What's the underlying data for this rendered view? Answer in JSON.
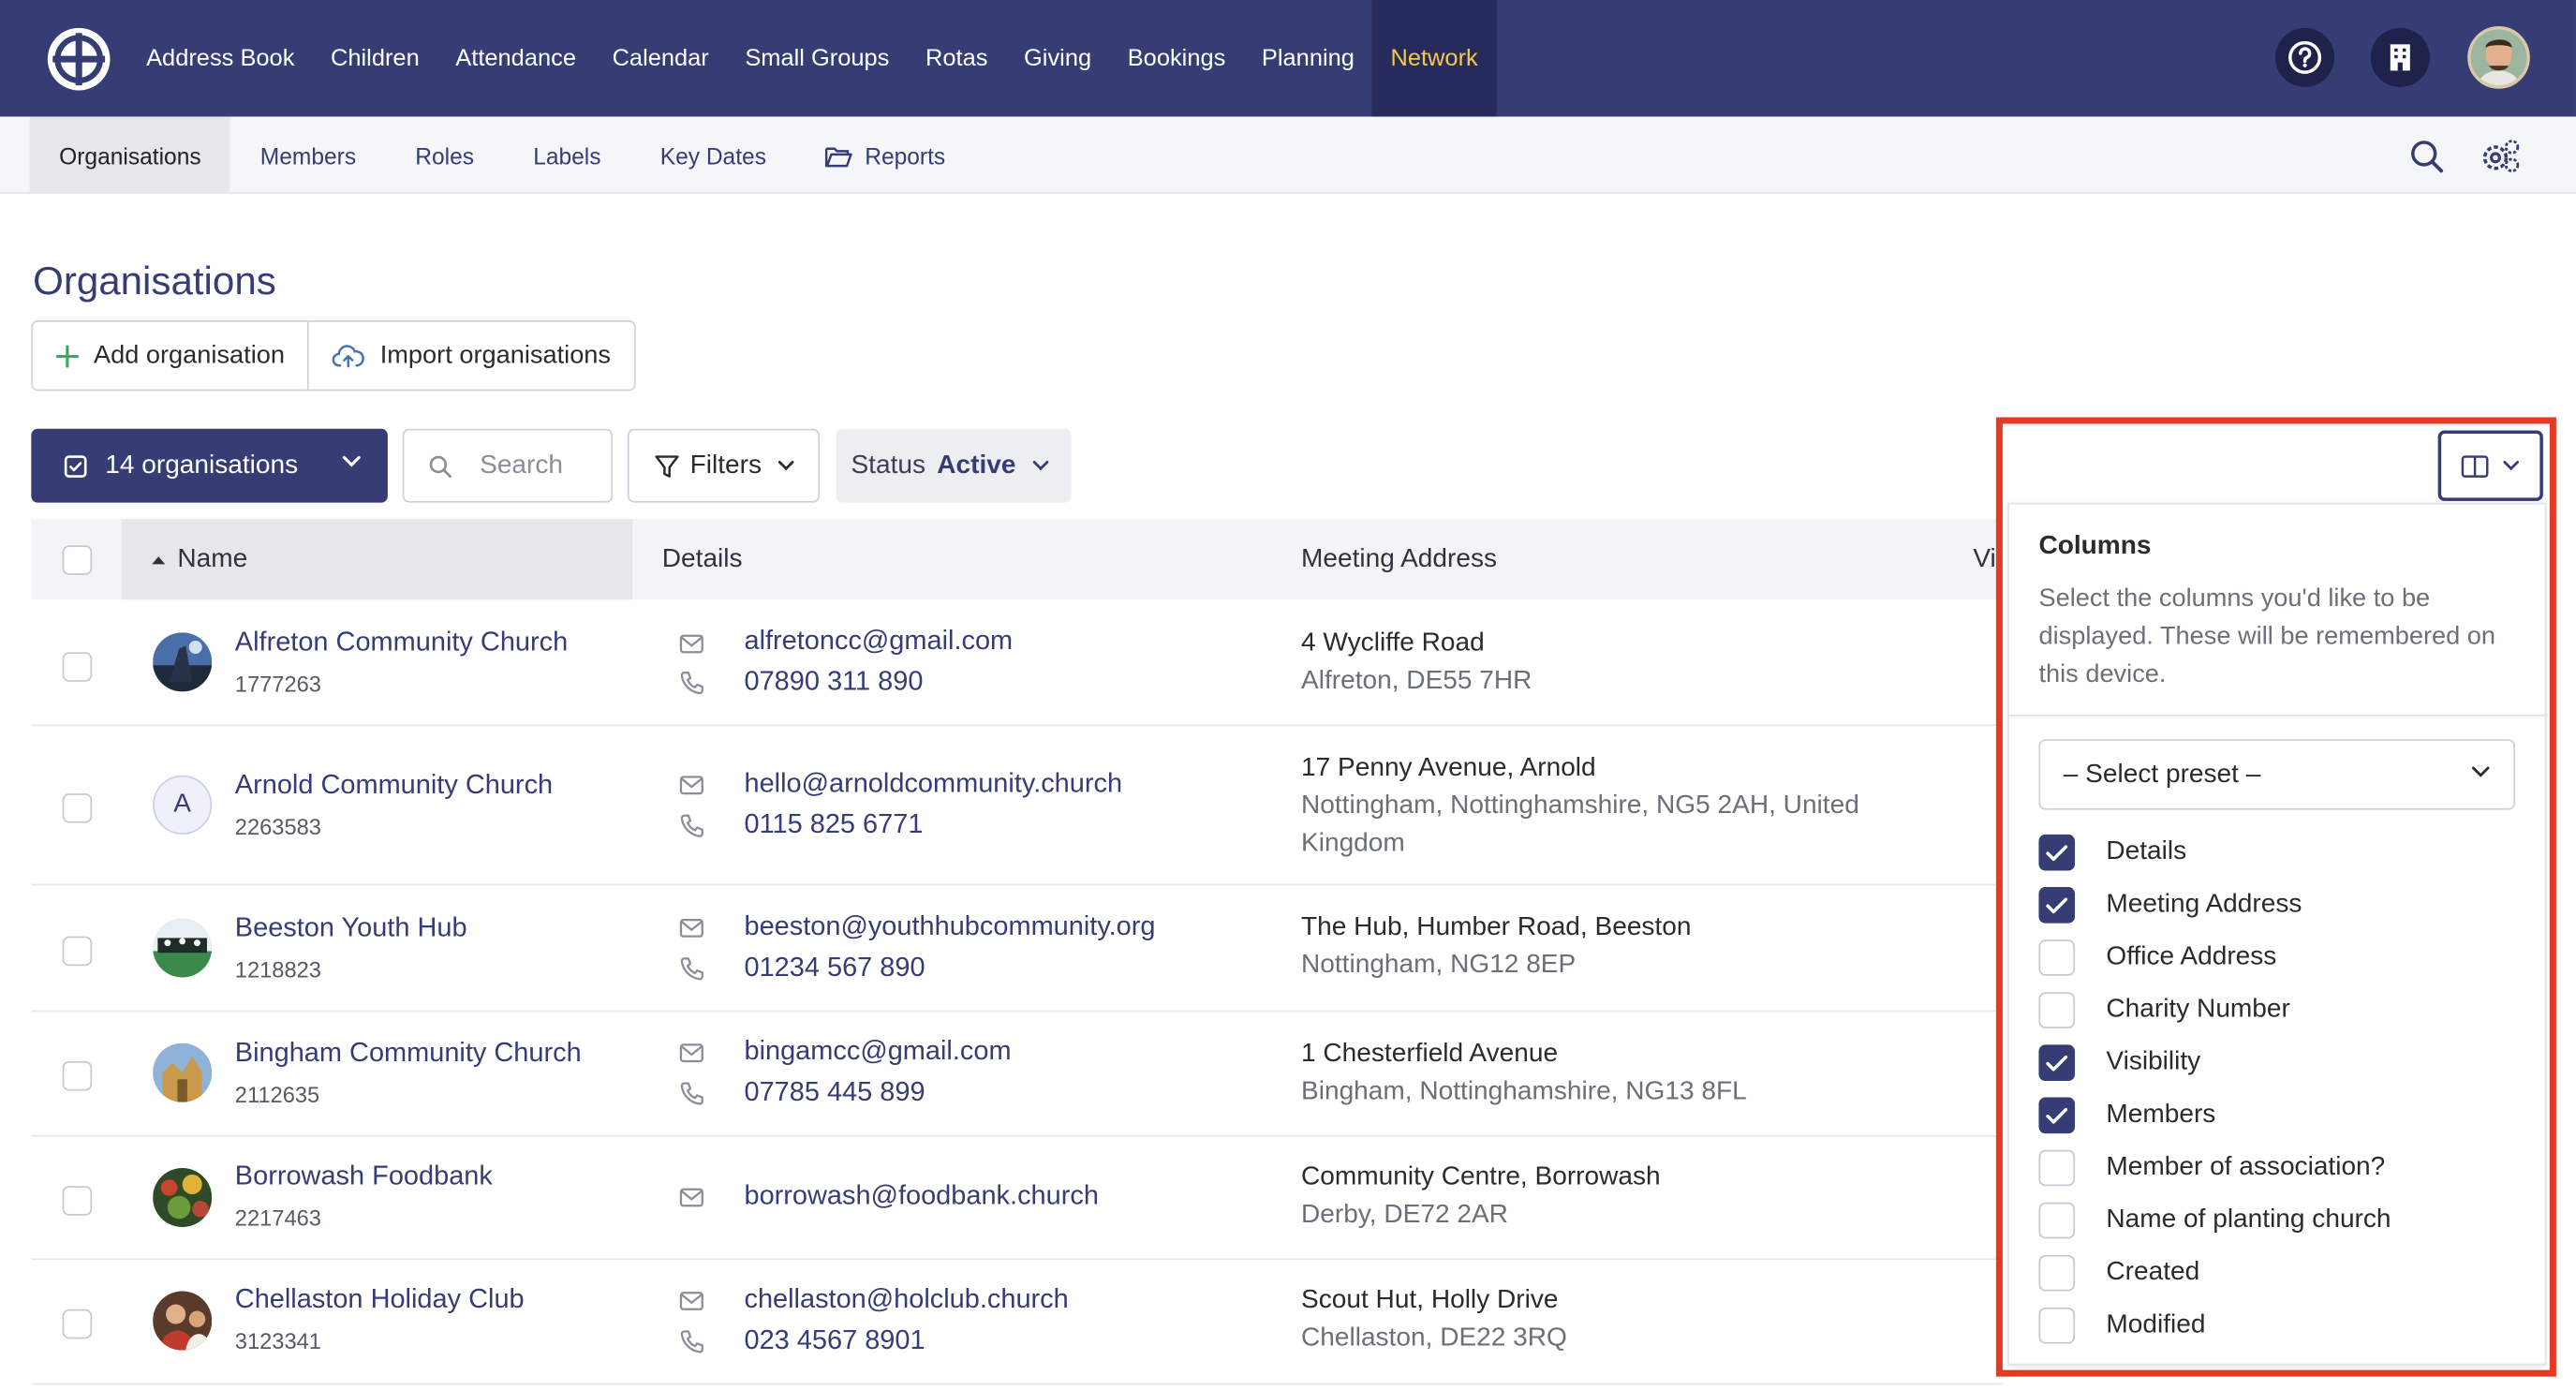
{
  "topnav": {
    "items": [
      "Address Book",
      "Children",
      "Attendance",
      "Calendar",
      "Small Groups",
      "Rotas",
      "Giving",
      "Bookings",
      "Planning",
      "Network"
    ],
    "active": "Network",
    "colors": {
      "bg": "#363c74",
      "active_bg": "#262b5c",
      "active_text": "#f2c94c"
    }
  },
  "subnav": {
    "items": [
      "Organisations",
      "Members",
      "Roles",
      "Labels",
      "Key Dates",
      "Reports"
    ],
    "active": "Organisations"
  },
  "page": {
    "title": "Organisations",
    "add_label": "Add organisation",
    "import_label": "Import organisations"
  },
  "toolbar": {
    "count_label": "14 organisations",
    "search_placeholder": "Search",
    "filters_label": "Filters",
    "status_label": "Status",
    "status_value": "Active"
  },
  "table": {
    "headers": {
      "name": "Name",
      "details": "Details",
      "address": "Meeting Address",
      "visibility_cut": "Vi"
    },
    "rows": [
      {
        "name": "Alfreton Community Church",
        "id": "1777263",
        "email": "alfretoncc@gmail.com",
        "phone": "07890 311 890",
        "addr1": "4 Wycliffe Road",
        "addr2": "Alfreton, DE55 7HR"
      },
      {
        "name": "Arnold Community Church",
        "id": "2263583",
        "initial": "A",
        "email": "hello@arnoldcommunity.church",
        "phone": "0115 825 6771",
        "addr1": "17 Penny Avenue, Arnold",
        "addr2": "Nottingham, Nottinghamshire, NG5 2AH, United Kingdom"
      },
      {
        "name": "Beeston Youth Hub",
        "id": "1218823",
        "email": "beeston@youthhubcommunity.org",
        "phone": "01234 567 890",
        "addr1": "The Hub, Humber Road, Beeston",
        "addr2": "Nottingham, NG12 8EP"
      },
      {
        "name": "Bingham Community Church",
        "id": "2112635",
        "email": "bingamcc@gmail.com",
        "phone": "07785 445 899",
        "addr1": "1 Chesterfield Avenue",
        "addr2": "Bingham, Nottinghamshire, NG13 8FL"
      },
      {
        "name": "Borrowash Foodbank",
        "id": "2217463",
        "email": "borrowash@foodbank.church",
        "phone": "",
        "addr1": "Community Centre, Borrowash",
        "addr2": "Derby, DE72 2AR"
      },
      {
        "name": "Chellaston Holiday Club",
        "id": "3123341",
        "email": "chellaston@holclub.church",
        "phone": "023 4567 8901",
        "addr1": "Scout Hut, Holly Drive",
        "addr2": "Chellaston, DE22 3RQ"
      }
    ]
  },
  "columns_panel": {
    "title": "Columns",
    "description": "Select the columns you'd like to be displayed. These will be remembered on this device.",
    "preset_placeholder": "– Select preset –",
    "options": [
      {
        "label": "Details",
        "checked": true
      },
      {
        "label": "Meeting Address",
        "checked": true
      },
      {
        "label": "Office Address",
        "checked": false
      },
      {
        "label": "Charity Number",
        "checked": false
      },
      {
        "label": "Visibility",
        "checked": true
      },
      {
        "label": "Members",
        "checked": true
      },
      {
        "label": "Member of association?",
        "checked": false
      },
      {
        "label": "Name of planting church",
        "checked": false
      },
      {
        "label": "Created",
        "checked": false
      },
      {
        "label": "Modified",
        "checked": false
      }
    ],
    "highlight_color": "#e53a24"
  }
}
